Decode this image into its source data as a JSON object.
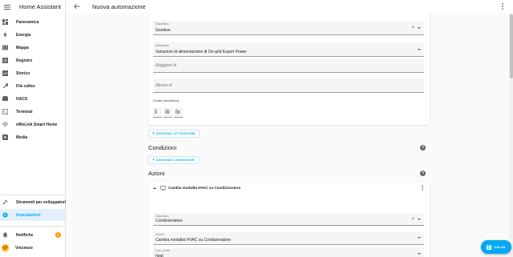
{
  "app": {
    "title": "Home Assistant"
  },
  "sidebar": {
    "items": [
      {
        "label": "Panoramica",
        "icon": "dashboard-icon"
      },
      {
        "label": "Energia",
        "icon": "lightning-icon"
      },
      {
        "label": "Mappa",
        "icon": "map-icon"
      },
      {
        "label": "Registro",
        "icon": "list-icon"
      },
      {
        "label": "Storico",
        "icon": "chart-icon"
      },
      {
        "label": "File editor",
        "icon": "wrench-icon"
      },
      {
        "label": "HACS",
        "icon": "hacs-icon"
      },
      {
        "label": "Terminal",
        "icon": "terminal-icon"
      },
      {
        "label": "eWeLink Smart Home",
        "icon": "ewelink-icon"
      },
      {
        "label": "Media",
        "icon": "play-icon"
      }
    ],
    "bottom": {
      "dev_tools": "Strumenti per sviluppatori",
      "settings": "Impostazioni",
      "notifications": "Notifiche",
      "notifications_count": "1",
      "user": "Vincenzo"
    }
  },
  "header": {
    "title": "Nuova automazione"
  },
  "trigger": {
    "device_label": "Dispositivo",
    "device_value": "Goodwe",
    "trigger_label": "Attivazione",
    "trigger_value": "Variazioni di alimentazione di On-grid Export Power",
    "above_placeholder": "Maggiore di",
    "below_placeholder": "Minore di",
    "duration_label": "Durata (facoltativo)",
    "duration": [
      {
        "unit": "hh",
        "value": "0"
      },
      {
        "unit": "mm",
        "value": "00"
      },
      {
        "unit": "ss",
        "value": "00"
      }
    ],
    "add_button": "AGGIUNGI ATTIVAZIONE"
  },
  "conditions": {
    "title": "Condizioni",
    "add_button": "AGGIUNGI CONDIZIONE"
  },
  "actions": {
    "title": "Azioni",
    "action_title": "Cambia modalità HVAC su Condizionatore",
    "device_label": "Dispositivo",
    "device_value": "Condizionatore",
    "action_label": "Azione",
    "action_value": "Cambia modalità HVAC su Condizionatore",
    "mode_label": "hvac_mode",
    "mode_value": "heat"
  },
  "save_button": "SALVA",
  "colors": {
    "accent": "#03a9f4",
    "badge": "#ff9800"
  }
}
